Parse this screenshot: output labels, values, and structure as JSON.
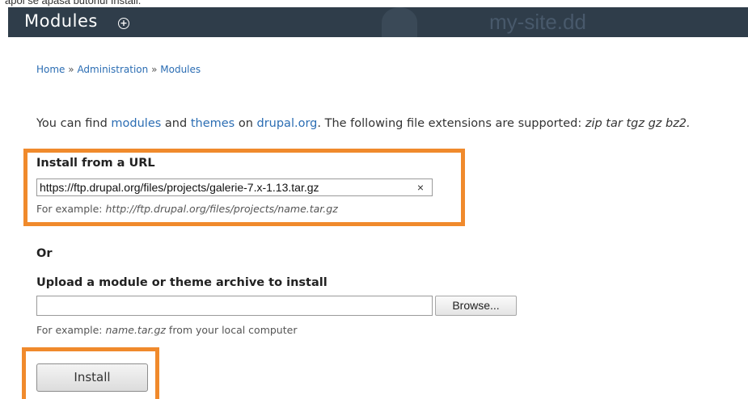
{
  "caption": "apoi se apasă butonul Install.",
  "header": {
    "title": "Modules",
    "site_name": "my-site.dd"
  },
  "breadcrumb": {
    "items": [
      "Home",
      "Administration",
      "Modules"
    ],
    "separator": "»"
  },
  "intro": {
    "prefix": "You can find ",
    "link_modules": "modules",
    "and": " and ",
    "link_themes": "themes",
    "on": " on ",
    "link_drupal": "drupal.org",
    "suffix": ". The following file extensions are supported: ",
    "extensions": "zip tar tgz gz bz2."
  },
  "install_url": {
    "label": "Install from a URL",
    "value": "https://ftp.drupal.org/files/projects/galerie-7.x-1.13.tar.gz",
    "clear_glyph": "×",
    "hint_prefix": "For example: ",
    "hint_example": "http://ftp.drupal.org/files/projects/name.tar.gz"
  },
  "or_label": "Or",
  "upload": {
    "label": "Upload a module or theme archive to install",
    "value": "",
    "browse_label": "Browse...",
    "hint_prefix": "For example: ",
    "hint_example": "name.tar.gz",
    "hint_suffix": " from your local computer"
  },
  "install_button": "Install",
  "colors": {
    "header_bg": "#2f3d4a",
    "link": "#2b6db3",
    "highlight": "#f08a2c"
  }
}
